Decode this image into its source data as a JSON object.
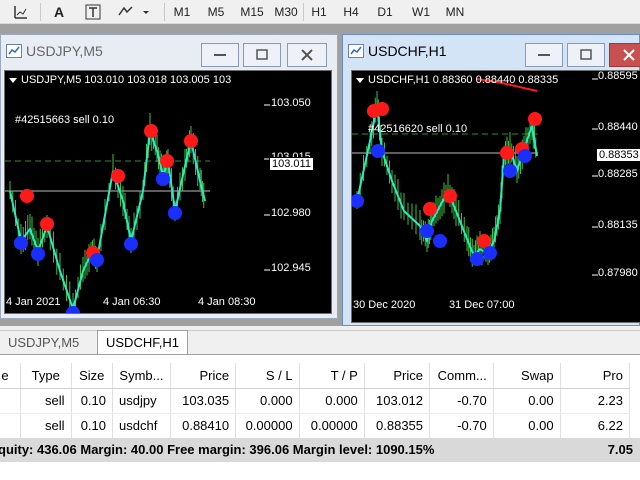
{
  "toolbar": {
    "icons": [
      "chart-tools-icon",
      "text-icon",
      "text-label-icon",
      "shapes-icon"
    ],
    "timeframes": [
      "M1",
      "M5",
      "M15",
      "M30",
      "H1",
      "H4",
      "D1",
      "W1",
      "MN"
    ]
  },
  "windows": [
    {
      "title": "USDJPY,M5",
      "header": "USDJPY,M5  103.010 103.018 103.005 103",
      "order_label": "#42515663 sell 0.10",
      "price_tag": "103.011",
      "y_ticks": [
        "103.050",
        "103.015",
        "102.980",
        "102.945"
      ],
      "x_ticks": [
        "4 Jan 2021",
        "4 Jan 06:30",
        "4 Jan 08:30"
      ]
    },
    {
      "title": "USDCHF,H1",
      "header": "USDCHF,H1  0.88360 0.88440 0.88335",
      "order_label": "#42516620 sell 0.10",
      "price_tag": "0.88353",
      "y_ticks": [
        "0.88595",
        "0.88440",
        "0.88285",
        "0.88135",
        "0.87980"
      ],
      "x_ticks": [
        "30 Dec 2020",
        "31 Dec 07:00"
      ]
    }
  ],
  "tabs": [
    "USDJPY,M5",
    "USDCHF,H1"
  ],
  "active_tab": 1,
  "table": {
    "headers": [
      "e",
      "Type",
      "Size",
      "Symb...",
      "Price",
      "S / L",
      "T / P",
      "Price",
      "Comm...",
      "Swap",
      "Pro"
    ],
    "rows": [
      [
        "",
        "sell",
        "0.10",
        "usdjpy",
        "103.035",
        "0.000",
        "0.000",
        "103.012",
        "-0.70",
        "0.00",
        "2.23"
      ],
      [
        "",
        "sell",
        "0.10",
        "usdchf",
        "0.88410",
        "0.00000",
        "0.00000",
        "0.88355",
        "-0.70",
        "0.00",
        "6.22"
      ]
    ]
  },
  "summary": {
    "text": "quity: 436.06  Margin: 40.00  Free margin: 396.06  Margin level: 1090.15%",
    "profit": "7.05"
  },
  "colors": {
    "price_line": "#2ee8c0",
    "bar": "#3fbf3f",
    "sell_marker": "#ff1a1a",
    "buy_marker": "#1a2eff",
    "order_line": "#2e8b2e"
  }
}
